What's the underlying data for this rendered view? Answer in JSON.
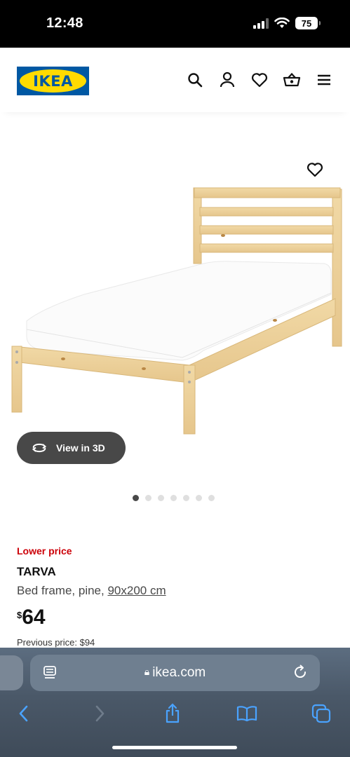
{
  "status_bar": {
    "time": "12:48",
    "battery": "75"
  },
  "header": {
    "logo_text": "IKEA",
    "icons": [
      "search-icon",
      "account-icon",
      "heart-icon",
      "cart-icon",
      "menu-icon"
    ]
  },
  "gallery": {
    "view_3d_label": "View in 3D",
    "dot_count": 7,
    "active_dot": 0
  },
  "product": {
    "badge": "Lower price",
    "name": "TARVA",
    "description": "Bed frame, pine, ",
    "size": "90x200 cm",
    "currency": "$",
    "price": "64",
    "previous_price": "Previous price: $94"
  },
  "browser": {
    "url": "ikea.com",
    "icons": [
      "reader-icon",
      "lock-icon",
      "reload-icon",
      "back-icon",
      "forward-icon",
      "share-icon",
      "bookmarks-icon",
      "tabs-icon"
    ]
  },
  "colors": {
    "brand_blue": "#0058a3",
    "brand_yellow": "#ffdb00",
    "price_red": "#cc0008"
  }
}
